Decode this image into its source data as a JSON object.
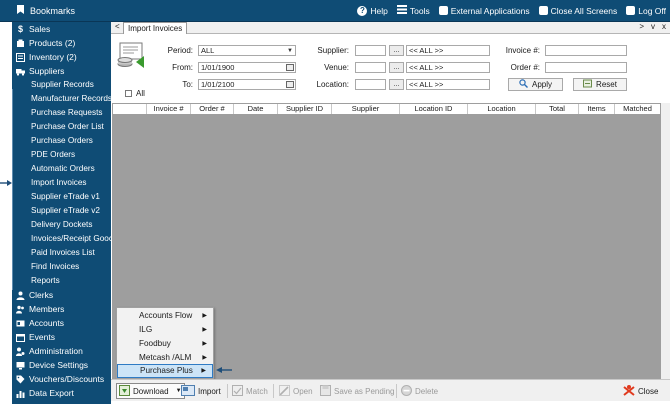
{
  "topbar": {
    "bookmarks": "Bookmarks",
    "help": "Help",
    "tools": "Tools",
    "external": "External Applications",
    "close_all": "Close All Screens",
    "logoff": "Log Off"
  },
  "sidebar": {
    "sales": "Sales",
    "products": "Products (2)",
    "inventory": "Inventory (2)",
    "suppliers": "Suppliers",
    "supplier_sub": [
      "Supplier Records",
      "Manufacturer Records",
      "Purchase Requests",
      "Purchase Order List",
      "Purchase Orders",
      "PDE Orders",
      "Automatic Orders",
      "Import Invoices",
      "Supplier eTrade v1",
      "Supplier eTrade v2",
      "Delivery Dockets",
      "Invoices/Receipt Gooc",
      "Paid Invoices List",
      "Find Invoices",
      "Reports"
    ],
    "clerks": "Clerks",
    "members": "Members",
    "accounts": "Accounts",
    "events": "Events",
    "administration": "Administration",
    "device_settings": "Device Settings",
    "vouchers": "Vouchers/Discounts",
    "data_export": "Data Export"
  },
  "tabs": {
    "prev": "<",
    "active": "Import Invoices",
    "controls": [
      ">",
      "v",
      "x"
    ]
  },
  "filters": {
    "period_label": "Period:",
    "period_value": "ALL",
    "from_label": "From:",
    "from_value": "1/01/1900",
    "to_label": "To:",
    "to_value": "1/01/2100",
    "all_label": "All",
    "supplier_label": "Supplier:",
    "supplier_value": "<< ALL >>",
    "venue_label": "Venue:",
    "venue_value": "<< ALL >>",
    "location_label": "Location:",
    "location_value": "<< ALL >>",
    "invoice_label": "Invoice #:",
    "order_label": "Order #:",
    "browse": "...",
    "apply": "Apply",
    "reset": "Reset"
  },
  "grid": {
    "columns": [
      "Invoice #",
      "Order #",
      "Date",
      "Supplier ID",
      "Supplier",
      "Location ID",
      "Location",
      "Total",
      "Items",
      "Matched"
    ]
  },
  "dropdown_menu": {
    "items": [
      "Accounts Flow",
      "ILG",
      "Foodbuy",
      "Metcash /ALM",
      "Purchase Plus"
    ],
    "highlighted": "Purchase Plus"
  },
  "bottombar": {
    "download": "Download",
    "import": "Import",
    "match": "Match",
    "open": "Open",
    "save_pending": "Save as Pending",
    "delete": "Delete",
    "close": "Close"
  },
  "colors": {
    "nav": "#0f4c75",
    "grid": "#9e9e9e",
    "highlight": "#cce4f7",
    "arrow": "#1f4e79"
  }
}
